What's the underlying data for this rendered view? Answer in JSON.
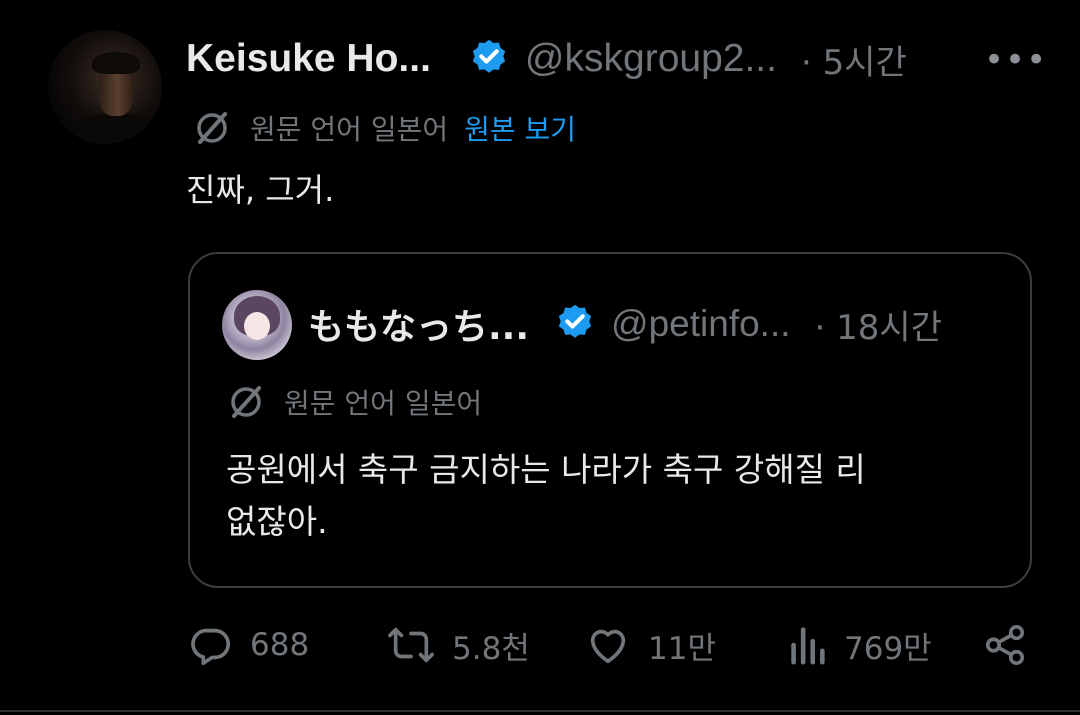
{
  "tweet": {
    "author_name": "Keisuke Ho...",
    "author_handle": "@kskgroup2...",
    "time": "· 5시간",
    "more_label": "•••",
    "translation_note": "원문 언어 일본어",
    "show_original": "원본 보기",
    "text": "진짜, 그거."
  },
  "quote": {
    "author_name": "ももなっち...",
    "author_handle": "@petinfo...",
    "time": "· 18시간",
    "translation_note": "원문 언어 일본어",
    "text_line1": "공원에서 축구 금지하는 나라가 축구 강해질 리",
    "text_line2": "없잖아."
  },
  "actions": {
    "replies": "688",
    "reposts": "5.8천",
    "likes": "11만",
    "views": "769만"
  },
  "icons": {
    "verified": "verified-badge-icon",
    "translate": "translate-icon",
    "reply": "reply-icon",
    "repost": "repost-icon",
    "like": "heart-icon",
    "views": "views-icon",
    "share": "share-icon"
  },
  "colors": {
    "background": "#000000",
    "text": "#e7e9ea",
    "secondary": "#71767b",
    "accent": "#1d9bf0",
    "border": "#3a3d41"
  }
}
